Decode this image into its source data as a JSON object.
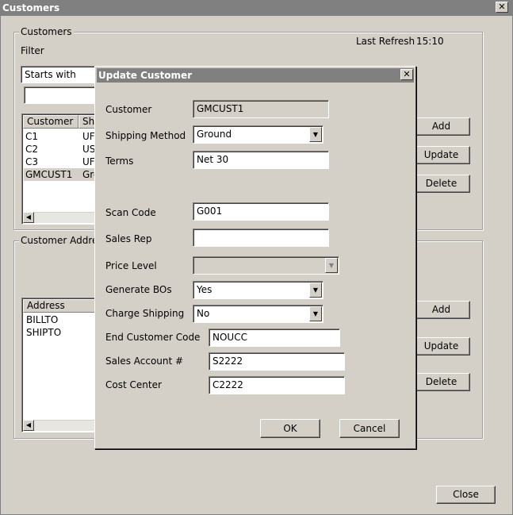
{
  "window": {
    "title": "Customers"
  },
  "customers_group": {
    "legend": "Customers",
    "filter_label": "Filter",
    "last_refresh_label": "Last Refresh",
    "last_refresh_time": "15:10",
    "filter_mode": "Starts with",
    "filter_value": "",
    "columns": [
      "Customer",
      "Sh"
    ],
    "rows": [
      {
        "customer": "C1",
        "ship": "UF"
      },
      {
        "customer": "C2",
        "ship": "US"
      },
      {
        "customer": "C3",
        "ship": "UF"
      },
      {
        "customer": "GMCUST1",
        "ship": "Gro"
      }
    ],
    "add_label": "Add",
    "update_label": "Update",
    "delete_label": "Delete"
  },
  "address_group": {
    "legend": "Customer Addres",
    "column": "Address",
    "rows": [
      "BILLTO",
      "SHIPTO"
    ],
    "add_label": "Add",
    "update_label": "Update",
    "delete_label": "Delete"
  },
  "close_label": "Close",
  "dialog": {
    "title": "Update Customer",
    "close_glyph": "✕",
    "customer_label": "Customer",
    "customer_value": "GMCUST1",
    "shipping_method_label": "Shipping Method",
    "shipping_method_value": "Ground",
    "terms_label": "Terms",
    "terms_value": "Net 30",
    "scan_code_label": "Scan Code",
    "scan_code_value": "G001",
    "sales_rep_label": "Sales Rep",
    "sales_rep_value": "",
    "price_level_label": "Price Level",
    "price_level_value": "",
    "generate_bos_label": "Generate BOs",
    "generate_bos_value": "Yes",
    "charge_shipping_label": "Charge Shipping",
    "charge_shipping_value": "No",
    "end_customer_code_label": "End Customer Code",
    "end_customer_code_value": "NOUCC",
    "sales_account_label": "Sales Account #",
    "sales_account_value": "S2222",
    "cost_center_label": "Cost Center",
    "cost_center_value": "C2222",
    "ok_label": "OK",
    "cancel_label": "Cancel"
  }
}
